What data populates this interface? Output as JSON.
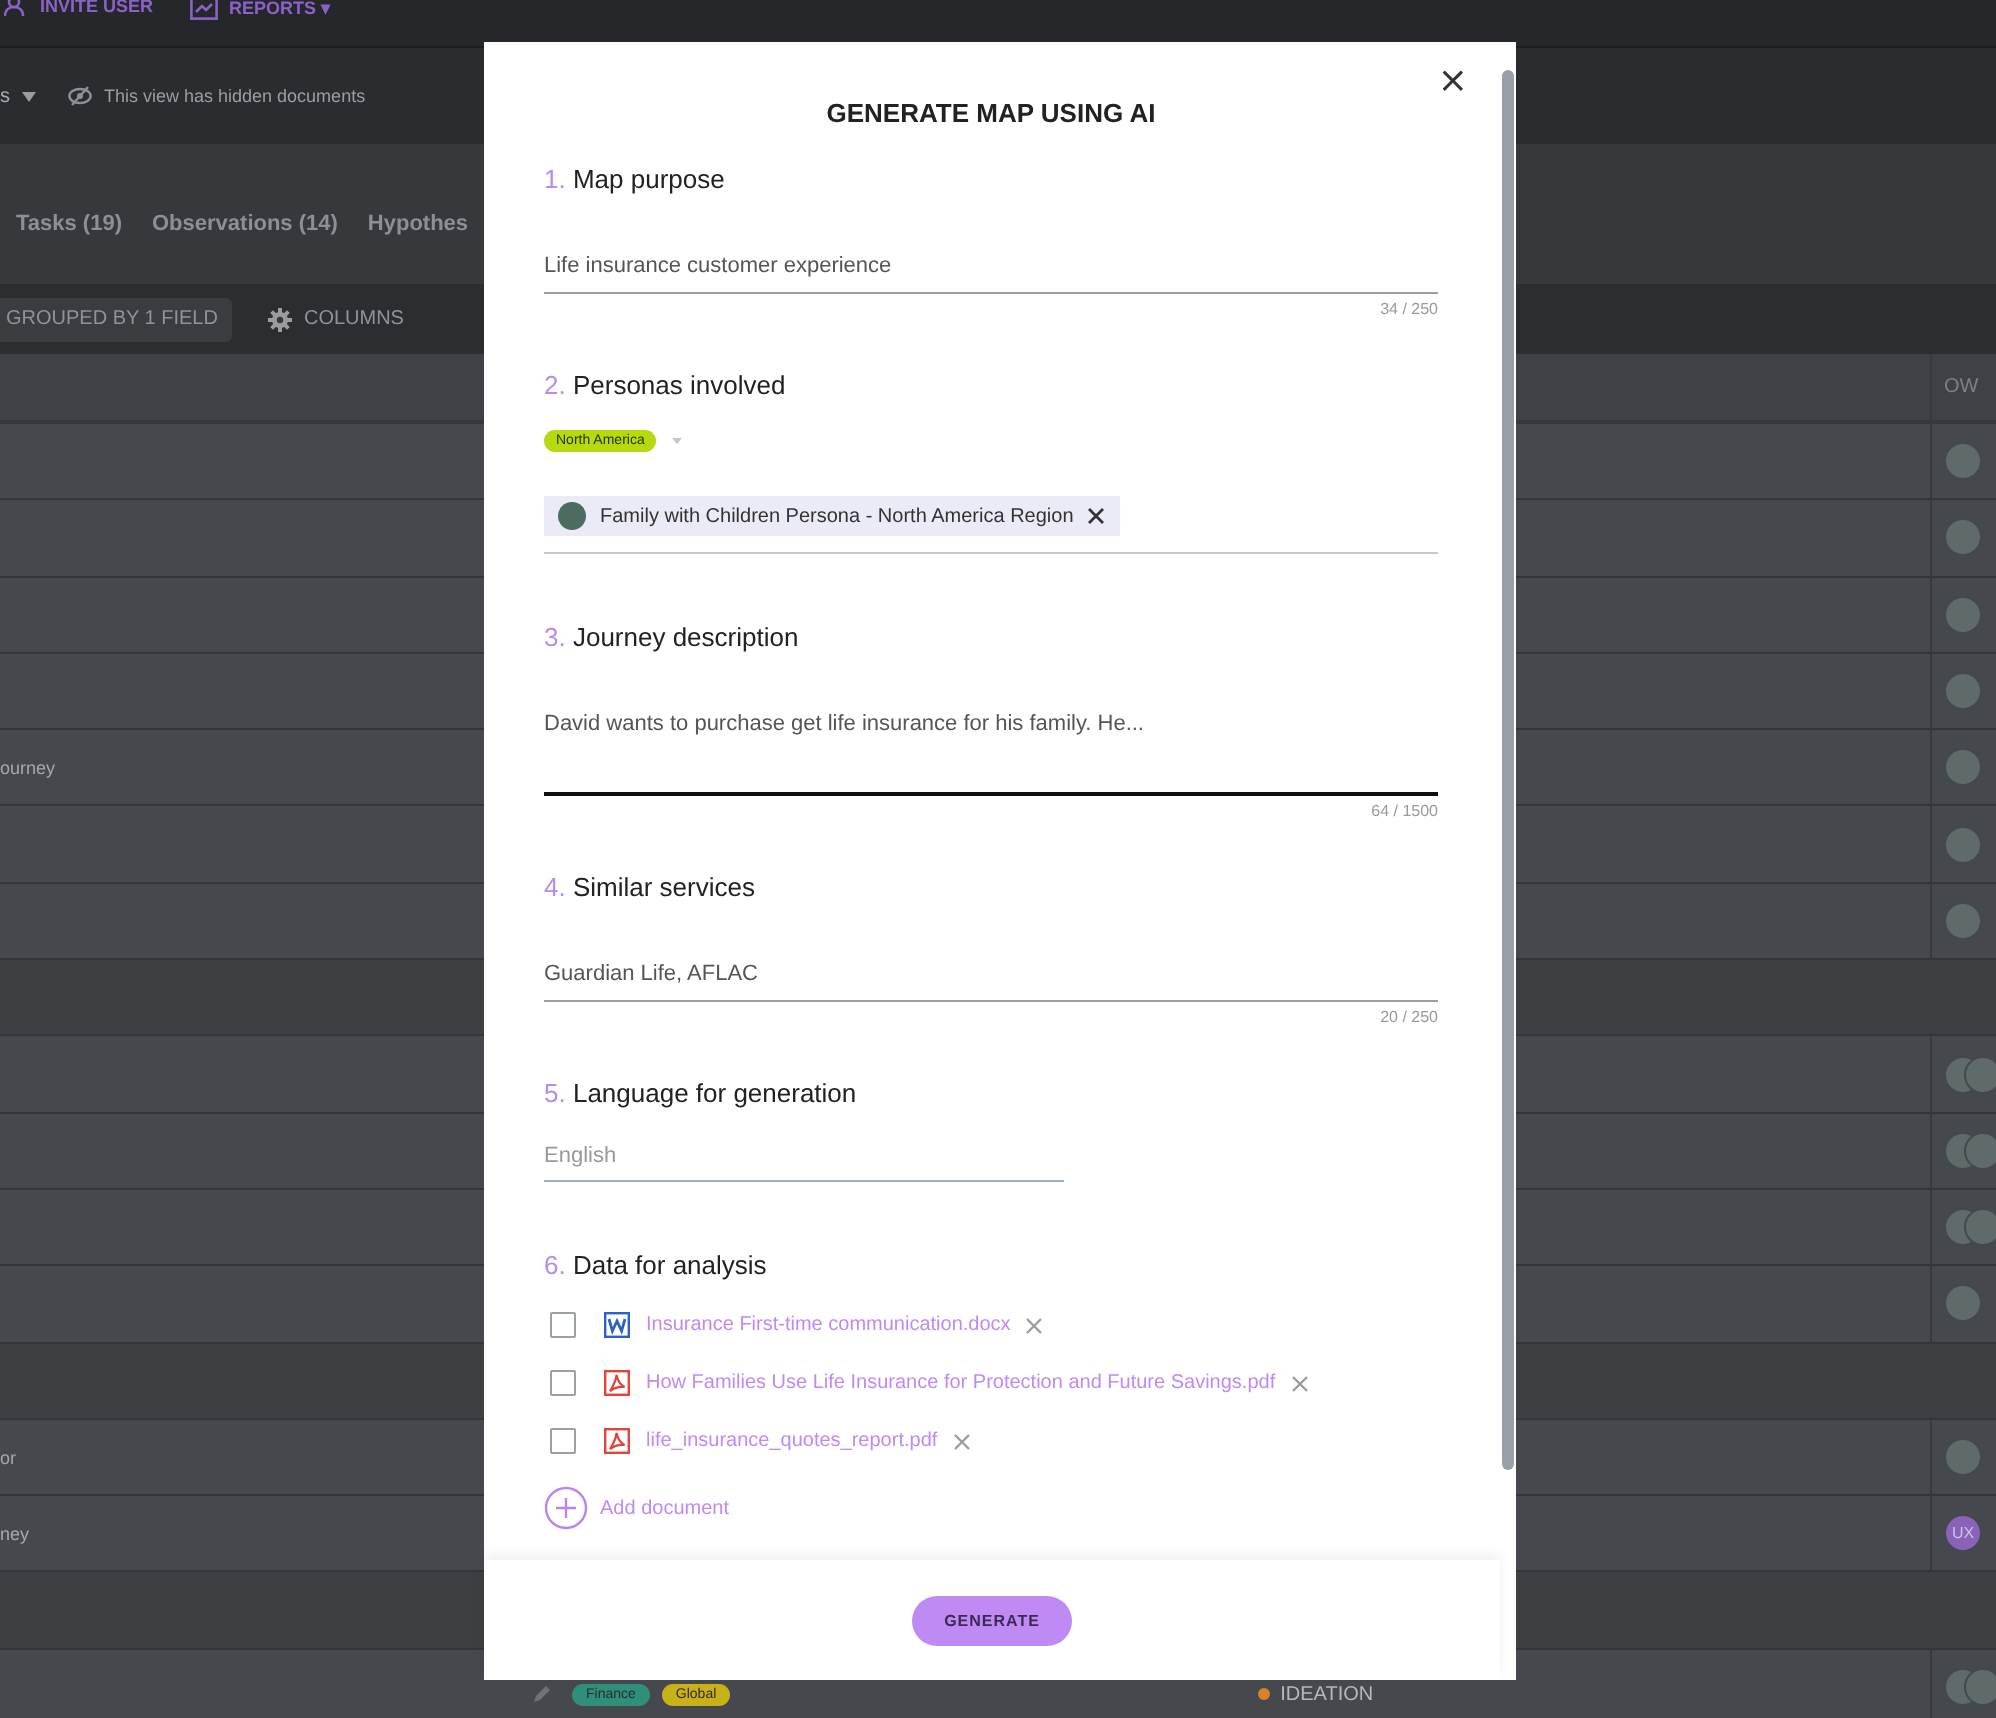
{
  "top_bar": {
    "links": [
      {
        "label": "INVITE USER"
      },
      {
        "label": "REPORTS ▾"
      }
    ]
  },
  "view_bar": {
    "view_label": "s",
    "notice": "This view has hidden documents"
  },
  "tabs": [
    {
      "label": "Tasks (19)",
      "selected": false
    },
    {
      "label": "Observations (14)",
      "selected": false
    },
    {
      "label": "Hypothes",
      "selected": false
    }
  ],
  "toolbar": {
    "grouping": "GROUPED BY 1 FIELD",
    "columns": "COLUMNS"
  },
  "table": {
    "columns": [
      {
        "label": "OW"
      }
    ],
    "rows": [
      {
        "kind": "item",
        "owners": [
          {
            "kind": "photo"
          }
        ]
      },
      {
        "kind": "item",
        "owners": [
          {
            "kind": "photo"
          }
        ]
      },
      {
        "kind": "item",
        "owners": [
          {
            "kind": "photo"
          }
        ]
      },
      {
        "kind": "item",
        "owners": [
          {
            "kind": "photo"
          }
        ]
      },
      {
        "kind": "item",
        "title": "ourney",
        "owners": [
          {
            "kind": "photo"
          }
        ]
      },
      {
        "kind": "item",
        "owners": [
          {
            "kind": "photo"
          }
        ]
      },
      {
        "kind": "item",
        "owners": [
          {
            "kind": "photo"
          }
        ]
      },
      {
        "kind": "group"
      },
      {
        "kind": "item",
        "owners": [
          {
            "kind": "photo"
          },
          {
            "kind": "photo"
          }
        ]
      },
      {
        "kind": "item",
        "owners": [
          {
            "kind": "photo"
          },
          {
            "kind": "photo"
          }
        ]
      },
      {
        "kind": "item",
        "owners": [
          {
            "kind": "photo"
          },
          {
            "kind": "photo"
          }
        ]
      },
      {
        "kind": "item",
        "owners": [
          {
            "kind": "photo"
          }
        ]
      },
      {
        "kind": "group"
      },
      {
        "kind": "item",
        "title": "or",
        "owners": [
          {
            "kind": "photo"
          }
        ]
      },
      {
        "kind": "item",
        "title": "ney",
        "owners": [
          {
            "kind": "initials",
            "text": "UX"
          }
        ]
      },
      {
        "kind": "group"
      },
      {
        "kind": "item",
        "tags": [
          {
            "label": "Finance",
            "color": "#2f8f7a"
          },
          {
            "label": "Global",
            "color": "#c9b11a"
          }
        ],
        "status": {
          "label": "IDEATION",
          "color": "#d9822b"
        },
        "owners": [
          {
            "kind": "photo"
          },
          {
            "kind": "photo"
          }
        ]
      }
    ]
  },
  "modal": {
    "title": "GENERATE MAP USING AI",
    "close": "×",
    "sections": [
      {
        "number": "1.",
        "label": "Map purpose",
        "kind": "text",
        "value": "Life insurance customer experience",
        "counter": "34 / 250",
        "focused": false
      },
      {
        "number": "2.",
        "label": "Personas involved",
        "kind": "personas",
        "region": "North America",
        "persona": "Family with Children Persona - North America Region"
      },
      {
        "number": "3.",
        "label": "Journey description",
        "kind": "textarea",
        "value": "David wants to purchase get life insurance for his family. He...",
        "counter": "64 / 1500",
        "focused": true
      },
      {
        "number": "4.",
        "label": "Similar services",
        "kind": "text",
        "value": "Guardian Life, AFLAC",
        "counter": "20 / 250",
        "focused": false
      },
      {
        "number": "5.",
        "label": "Language for generation",
        "kind": "select",
        "placeholder": "English"
      },
      {
        "number": "6.",
        "label": "Data for analysis",
        "kind": "files",
        "files": [
          {
            "name": "Insurance First-time communication.docx",
            "kind": "word",
            "checked": false
          },
          {
            "name": "How Families Use Life Insurance for Protection and Future Savings.pdf",
            "kind": "pdf",
            "checked": false
          },
          {
            "name": "life_insurance_quotes_report.pdf",
            "kind": "pdf",
            "checked": false
          }
        ],
        "add": "Add document"
      }
    ],
    "button": "GENERATE"
  }
}
